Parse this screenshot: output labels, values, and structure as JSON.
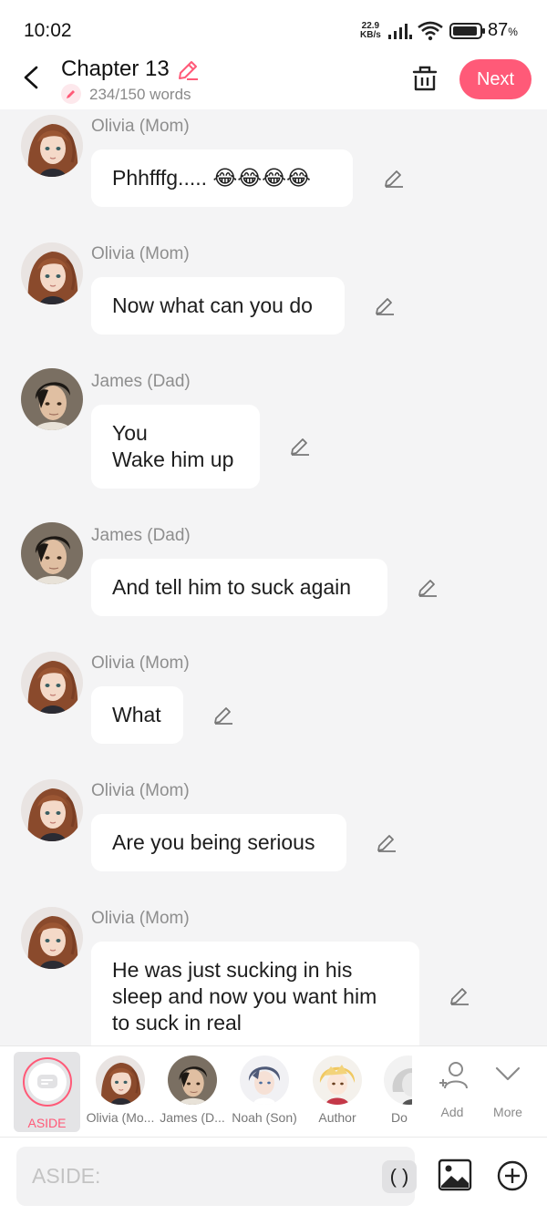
{
  "status_bar": {
    "time": "10:02",
    "net_speed_value": "22.9",
    "net_speed_unit": "KB/s",
    "battery_pct": "87",
    "battery_unit": "%"
  },
  "header": {
    "title": "Chapter 13",
    "word_count": "234/150 words",
    "next_label": "Next"
  },
  "colors": {
    "accent": "#ff5a78"
  },
  "messages": [
    {
      "speaker": "Olivia (Mom)",
      "text": "Phhfffg..... 😂😂😂😂",
      "avatar": "olivia-avatar"
    },
    {
      "speaker": "Olivia (Mom)",
      "text": "Now what can you do",
      "avatar": "olivia-avatar"
    },
    {
      "speaker": "James (Dad)",
      "line1": "You",
      "line2": "Wake him up",
      "avatar": "james-avatar"
    },
    {
      "speaker": "James (Dad)",
      "text": "And tell him to suck again",
      "avatar": "james-avatar"
    },
    {
      "speaker": "Olivia (Mom)",
      "text": "What",
      "avatar": "olivia-avatar"
    },
    {
      "speaker": "Olivia (Mom)",
      "text": "Are you being serious",
      "avatar": "olivia-avatar"
    },
    {
      "speaker": "Olivia (Mom)",
      "line1": "He was just sucking in his",
      "line2": "sleep and now you want him",
      "line3": "to suck in real",
      "avatar": "olivia-avatar"
    }
  ],
  "characters": [
    {
      "label": "ASIDE",
      "selected": true
    },
    {
      "label": "Olivia (Mo..."
    },
    {
      "label": "James (D..."
    },
    {
      "label": "Noah (Son)"
    },
    {
      "label": "Author"
    },
    {
      "label": "Do"
    }
  ],
  "controls": {
    "add_label": "Add",
    "more_label": "More"
  },
  "input": {
    "placeholder": "ASIDE:",
    "paren_label": "( )"
  }
}
